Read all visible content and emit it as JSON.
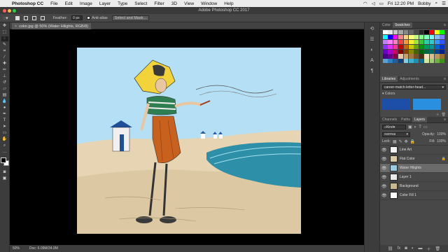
{
  "menubar": {
    "apple_icon": "",
    "items": [
      "Photoshop CC",
      "File",
      "Edit",
      "Image",
      "Layer",
      "Type",
      "Select",
      "Filter",
      "3D",
      "View",
      "Window",
      "Help"
    ],
    "status": {
      "clock": "Fri 12:20 PM",
      "user": "Bobby"
    }
  },
  "window": {
    "title": "Adobe Photoshop CC 2017"
  },
  "options_bar": {
    "feather_label": "Feather:",
    "feather_value": "0 px",
    "antialias_label": "Anti-alias",
    "select_mask_label": "Select and Mask..."
  },
  "document": {
    "tab_title": "color.jpg @ 50% (Water Hilights, RGB/8)",
    "close_icon": "×"
  },
  "status_bar": {
    "zoom": "50%",
    "doc_size": "Doc: 6.09M/34.9M"
  },
  "panels": {
    "color_tabs": [
      "Color",
      "Swatches"
    ],
    "library_tabs": [
      "Libraries",
      "Adjustments"
    ],
    "library_name": "career-match-letter-head...",
    "colors_label": "Colors",
    "library_colors": [
      "#1e4fa8",
      "#2b8fe0"
    ],
    "layer_tabs": [
      "Channels",
      "Paths",
      "Layers"
    ],
    "kind_filter": "Kind",
    "blend_mode": "Normal",
    "opacity_label": "Opacity:",
    "opacity_value": "100%",
    "lock_label": "Lock:",
    "fill_label": "Fill:",
    "fill_value": "100%",
    "layers": [
      {
        "name": "Line Art",
        "selected": false,
        "locked": false
      },
      {
        "name": "Flat Color",
        "selected": false,
        "locked": true
      },
      {
        "name": "Water Hilights",
        "selected": true,
        "locked": false
      },
      {
        "name": "Layer 1",
        "selected": false,
        "locked": false
      },
      {
        "name": "Background",
        "selected": false,
        "locked": false
      },
      {
        "name": "Color Fill 1",
        "selected": false,
        "locked": false
      }
    ]
  },
  "swatch_colors": [
    "#ffffff",
    "#e8e8e8",
    "#c8c8c8",
    "#a8a8a8",
    "#888888",
    "#686868",
    "#484848",
    "#282828",
    "#000000",
    "#ff0000",
    "#ffff00",
    "#00ff00",
    "#00ffff",
    "#0000ff",
    "#ff00ff",
    "#ff8080",
    "#ffd080",
    "#ffff80",
    "#c0ff80",
    "#80ff80",
    "#80ffc0",
    "#80ffff",
    "#80c0ff",
    "#8080ff",
    "#c080ff",
    "#ff80ff",
    "#ff80c0",
    "#ff4040",
    "#ff9933",
    "#ffee33",
    "#99ee33",
    "#33cc33",
    "#33ccaa",
    "#33cccc",
    "#3399ff",
    "#3355ff",
    "#8833ff",
    "#dd33ff",
    "#ff3399",
    "#cc0000",
    "#cc6600",
    "#cccc00",
    "#66aa00",
    "#009900",
    "#009966",
    "#009999",
    "#0066cc",
    "#0033cc",
    "#6600cc",
    "#aa00cc",
    "#cc0066",
    "#880000",
    "#884400",
    "#888800",
    "#446600",
    "#006600",
    "#006644",
    "#006666",
    "#004488",
    "#002288",
    "#440088",
    "#660088",
    "#880044",
    "#e6c8a0",
    "#c8a070",
    "#a07848",
    "#785028",
    "#503010",
    "#f0e0c0",
    "#d8c090",
    "#b89860",
    "#987030",
    "#5aa0d0",
    "#3080c0",
    "#2060a0",
    "#104080",
    "#80d0e0",
    "#40b0d0",
    "#2090b0",
    "#107090",
    "#d0e8a0",
    "#a0d070",
    "#70b040",
    "#409020"
  ]
}
